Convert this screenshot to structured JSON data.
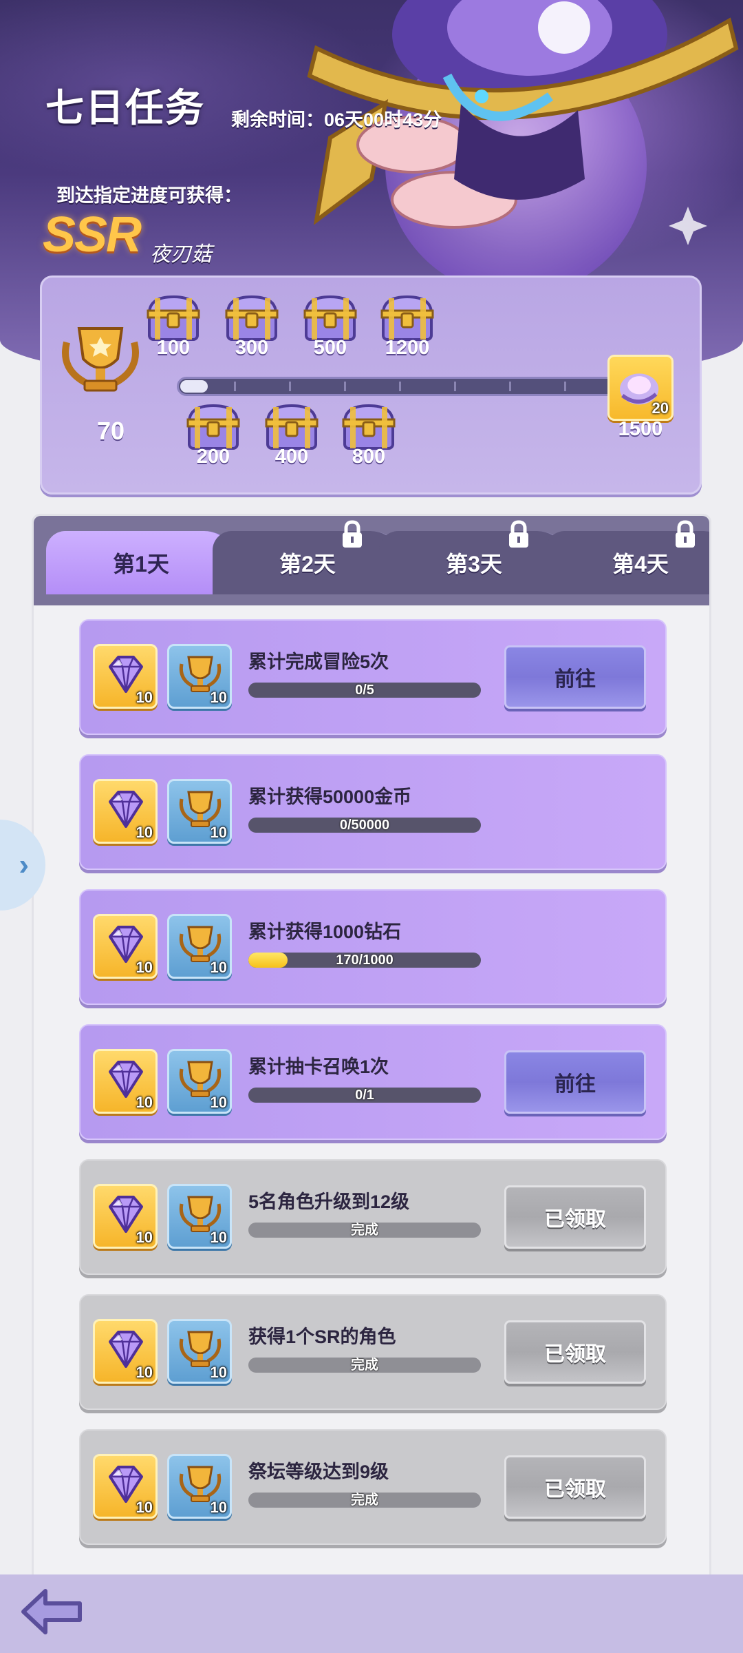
{
  "header": {
    "title": "七日任务",
    "timer": "剩余时间：06天00时43分",
    "reach_text": "到达指定进度可获得：",
    "rarity": "SSR",
    "character_name": "夜刃菇"
  },
  "progress": {
    "current_points": "70",
    "current_value": 70,
    "max_value": 1500,
    "milestones_top": [
      "100",
      "300",
      "500",
      "1200"
    ],
    "milestones_bottom": [
      "200",
      "400",
      "800"
    ],
    "final_milestone": "1500",
    "final_reward_count": "20"
  },
  "tabs": [
    {
      "label": "第1天",
      "active": true,
      "locked": false
    },
    {
      "label": "第2天",
      "active": false,
      "locked": true
    },
    {
      "label": "第3天",
      "active": false,
      "locked": true
    },
    {
      "label": "第4天",
      "active": false,
      "locked": true
    }
  ],
  "tasks": [
    {
      "title": "累计完成冒险5次",
      "progress_text": "0/5",
      "progress": 0.0,
      "button": "前往",
      "state": "go",
      "gem_count": "10",
      "trophy_count": "10"
    },
    {
      "title": "累计获得50000金币",
      "progress_text": "0/50000",
      "progress": 0.0,
      "button": "",
      "state": "none",
      "gem_count": "10",
      "trophy_count": "10"
    },
    {
      "title": "累计获得1000钻石",
      "progress_text": "170/1000",
      "progress": 0.17,
      "button": "",
      "state": "none",
      "gem_count": "10",
      "trophy_count": "10"
    },
    {
      "title": "累计抽卡召唤1次",
      "progress_text": "0/1",
      "progress": 0.0,
      "button": "前往",
      "state": "go",
      "gem_count": "10",
      "trophy_count": "10"
    },
    {
      "title": "5名角色升级到12级",
      "progress_text": "完成",
      "progress": 1.0,
      "button": "已领取",
      "state": "claimed",
      "gem_count": "10",
      "trophy_count": "10"
    },
    {
      "title": "获得1个SR的角色",
      "progress_text": "完成",
      "progress": 1.0,
      "button": "已领取",
      "state": "claimed",
      "gem_count": "10",
      "trophy_count": "10"
    },
    {
      "title": "祭坛等级达到9级",
      "progress_text": "完成",
      "progress": 1.0,
      "button": "已领取",
      "state": "claimed",
      "gem_count": "10",
      "trophy_count": "10"
    }
  ],
  "icons": {
    "side_arrow": "chevron-right-icon",
    "back": "back-arrow-icon",
    "gem": "diamond-gem-icon",
    "trophy": "trophy-icon",
    "chest": "treasure-chest-icon",
    "lock": "lock-icon"
  },
  "colors": {
    "accent_purple": "#b48ef7",
    "go_button": "#8a86e4",
    "claimed_button": "#b4b4b8",
    "progress_yellow": "#f6c11a"
  }
}
